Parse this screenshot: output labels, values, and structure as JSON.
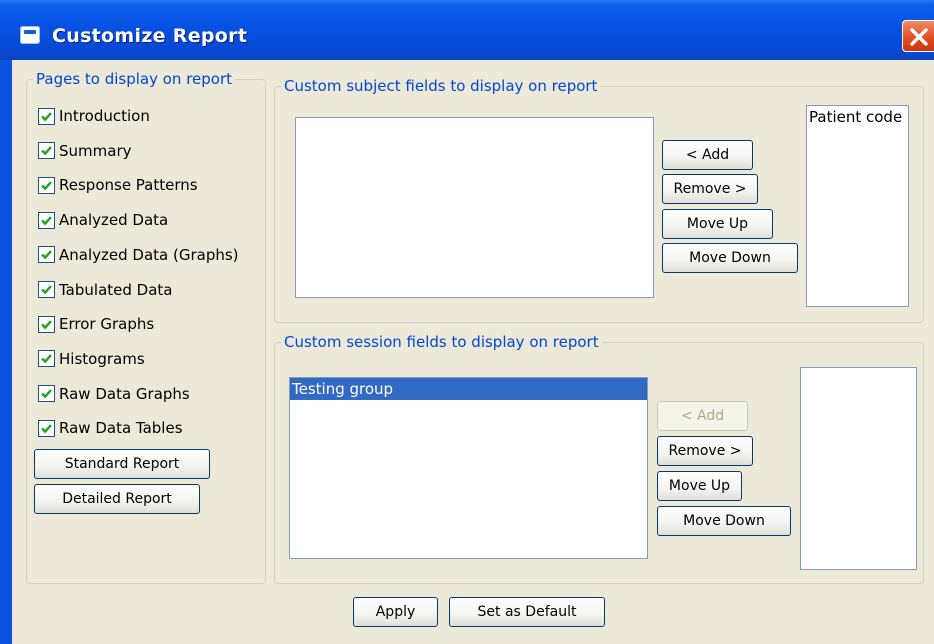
{
  "window": {
    "title": "Customize Report",
    "accent": "#0b5fec"
  },
  "pages": {
    "legend": "Pages to display on report",
    "items": [
      {
        "label": "Introduction",
        "checked": true
      },
      {
        "label": "Summary",
        "checked": true
      },
      {
        "label": "Response Patterns",
        "checked": true
      },
      {
        "label": "Analyzed Data",
        "checked": true
      },
      {
        "label": "Analyzed Data (Graphs)",
        "checked": true
      },
      {
        "label": "Tabulated Data",
        "checked": true
      },
      {
        "label": "Error Graphs",
        "checked": true
      },
      {
        "label": "Histograms",
        "checked": true
      },
      {
        "label": "Raw Data Graphs",
        "checked": true
      },
      {
        "label": "Raw Data Tables",
        "checked": true
      }
    ],
    "standard_label": "Standard Report",
    "detailed_label": "Detailed Report"
  },
  "subject": {
    "legend": "Custom subject fields to display on report",
    "available": [],
    "selected": [
      "Patient code"
    ],
    "add_label": "< Add",
    "remove_label": "Remove >",
    "moveup_label": "Move Up",
    "movedown_label": "Move Down"
  },
  "session": {
    "legend": "Custom session fields to display on report",
    "available": [
      "Testing group"
    ],
    "selected": [],
    "add_label": "< Add",
    "remove_label": "Remove >",
    "moveup_label": "Move Up",
    "movedown_label": "Move Down"
  },
  "footer": {
    "apply_label": "Apply",
    "default_label": "Set as Default"
  },
  "colors": {
    "checkmark": "#21a121",
    "selection": "#316ac5",
    "legend": "#0046d5"
  }
}
